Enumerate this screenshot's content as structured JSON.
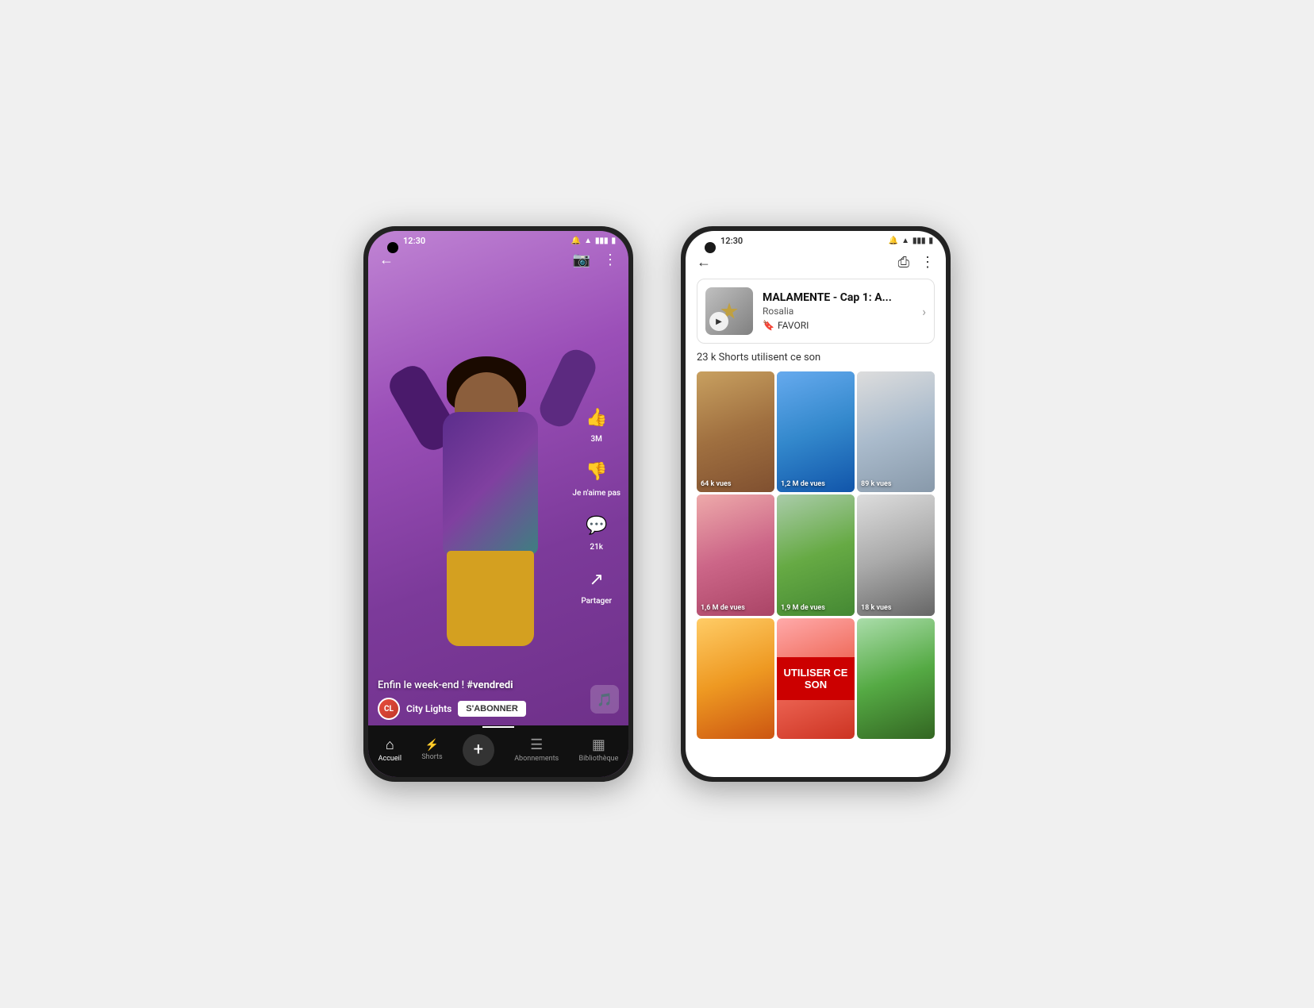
{
  "phone1": {
    "status_time": "12:30",
    "back_icon": "←",
    "camera_icon": "📷",
    "menu_icon": "⋮",
    "like_count": "3M",
    "dislike_label": "Je n'aime pas",
    "comment_count": "21k",
    "share_label": "Partager",
    "caption": "Enfin le week-end ! #vendredi",
    "channel_name": "City Lights",
    "subscribe_label": "S'ABONNER",
    "nav_items": [
      {
        "label": "Accueil",
        "icon": "⌂",
        "active": true
      },
      {
        "label": "Shorts",
        "icon": "▶",
        "active": false
      },
      {
        "label": "",
        "icon": "+",
        "active": false
      },
      {
        "label": "Abonnements",
        "icon": "☰",
        "active": false
      },
      {
        "label": "Bibliothèque",
        "icon": "▦",
        "active": false
      }
    ]
  },
  "phone2": {
    "status_time": "12:30",
    "back_icon": "←",
    "share_icon": "⎙",
    "menu_icon": "⋮",
    "sound_title": "MALAMENTE - Cap 1: A...",
    "sound_artist": "Rosalia",
    "sound_fav_label": "FAVORI",
    "sound_count_text": "23 k Shorts utilisent ce son",
    "use_sound_label": "UTILISER CE SON",
    "videos": [
      {
        "views": "64 k vues",
        "color": "vt1"
      },
      {
        "views": "1,2 M de vues",
        "color": "vt2"
      },
      {
        "views": "89 k vues",
        "color": "vt3"
      },
      {
        "views": "1,6 M de vues",
        "color": "vt4"
      },
      {
        "views": "1,9 M de vues",
        "color": "vt5"
      },
      {
        "views": "18 k vues",
        "color": "vt6"
      },
      {
        "views": "",
        "color": "vt7"
      },
      {
        "views": "",
        "color": "vt1"
      },
      {
        "views": "",
        "color": "vt5"
      }
    ]
  }
}
